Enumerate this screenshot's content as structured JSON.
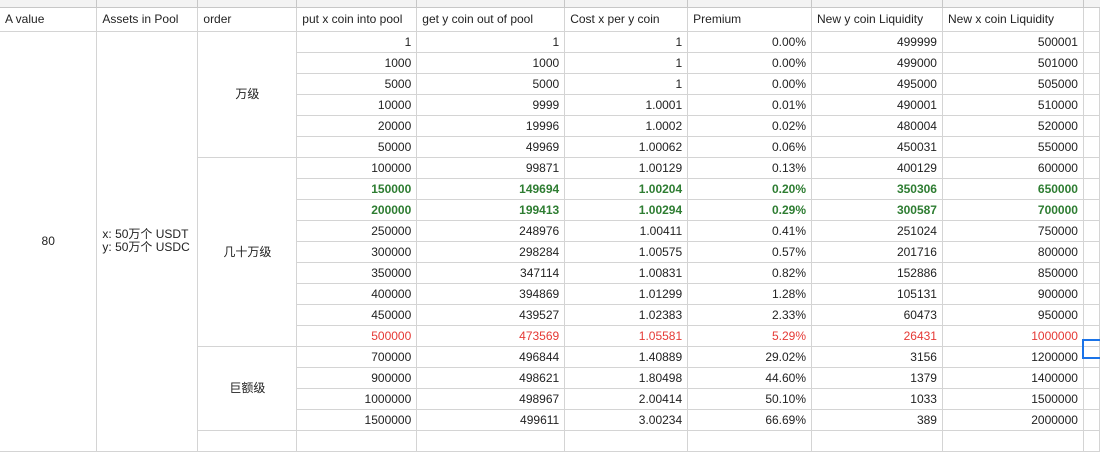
{
  "headers": [
    "A value",
    "Assets in Pool",
    "order",
    "put x coin into pool",
    "get y coin out of pool",
    "Cost x per y coin",
    "Premium",
    "New y coin Liquidity",
    "New x coin Liquidity"
  ],
  "a_value": "80",
  "assets": [
    "x: 50万个 USDT",
    "y: 50万个 USDC"
  ],
  "groups": [
    {
      "label": "万级",
      "start": 0,
      "span": 6
    },
    {
      "label": "几十万级",
      "start": 6,
      "span": 9
    },
    {
      "label": "巨额级",
      "start": 15,
      "span": 4
    }
  ],
  "rows": [
    {
      "put": "1",
      "get": "1",
      "cost": "1",
      "premium": "0.00%",
      "new_y": "499999",
      "new_x": "500001",
      "style": ""
    },
    {
      "put": "1000",
      "get": "1000",
      "cost": "1",
      "premium": "0.00%",
      "new_y": "499000",
      "new_x": "501000",
      "style": ""
    },
    {
      "put": "5000",
      "get": "5000",
      "cost": "1",
      "premium": "0.00%",
      "new_y": "495000",
      "new_x": "505000",
      "style": ""
    },
    {
      "put": "10000",
      "get": "9999",
      "cost": "1.0001",
      "premium": "0.01%",
      "new_y": "490001",
      "new_x": "510000",
      "style": ""
    },
    {
      "put": "20000",
      "get": "19996",
      "cost": "1.0002",
      "premium": "0.02%",
      "new_y": "480004",
      "new_x": "520000",
      "style": ""
    },
    {
      "put": "50000",
      "get": "49969",
      "cost": "1.00062",
      "premium": "0.06%",
      "new_y": "450031",
      "new_x": "550000",
      "style": ""
    },
    {
      "put": "100000",
      "get": "99871",
      "cost": "1.00129",
      "premium": "0.13%",
      "new_y": "400129",
      "new_x": "600000",
      "style": ""
    },
    {
      "put": "150000",
      "get": "149694",
      "cost": "1.00204",
      "premium": "0.20%",
      "new_y": "350306",
      "new_x": "650000",
      "style": "green"
    },
    {
      "put": "200000",
      "get": "199413",
      "cost": "1.00294",
      "premium": "0.29%",
      "new_y": "300587",
      "new_x": "700000",
      "style": "green"
    },
    {
      "put": "250000",
      "get": "248976",
      "cost": "1.00411",
      "premium": "0.41%",
      "new_y": "251024",
      "new_x": "750000",
      "style": ""
    },
    {
      "put": "300000",
      "get": "298284",
      "cost": "1.00575",
      "premium": "0.57%",
      "new_y": "201716",
      "new_x": "800000",
      "style": ""
    },
    {
      "put": "350000",
      "get": "347114",
      "cost": "1.00831",
      "premium": "0.82%",
      "new_y": "152886",
      "new_x": "850000",
      "style": ""
    },
    {
      "put": "400000",
      "get": "394869",
      "cost": "1.01299",
      "premium": "1.28%",
      "new_y": "105131",
      "new_x": "900000",
      "style": ""
    },
    {
      "put": "450000",
      "get": "439527",
      "cost": "1.02383",
      "premium": "2.33%",
      "new_y": "60473",
      "new_x": "950000",
      "style": ""
    },
    {
      "put": "500000",
      "get": "473569",
      "cost": "1.05581",
      "premium": "5.29%",
      "new_y": "26431",
      "new_x": "1000000",
      "style": "red"
    },
    {
      "put": "700000",
      "get": "496844",
      "cost": "1.40889",
      "premium": "29.02%",
      "new_y": "3156",
      "new_x": "1200000",
      "style": ""
    },
    {
      "put": "900000",
      "get": "498621",
      "cost": "1.80498",
      "premium": "44.60%",
      "new_y": "1379",
      "new_x": "1400000",
      "style": ""
    },
    {
      "put": "1000000",
      "get": "498967",
      "cost": "2.00414",
      "premium": "50.10%",
      "new_y": "1033",
      "new_x": "1500000",
      "style": ""
    },
    {
      "put": "1500000",
      "get": "499611",
      "cost": "3.00234",
      "premium": "66.69%",
      "new_y": "389",
      "new_x": "2000000",
      "style": ""
    }
  ],
  "colors": {
    "green": "#2e7d32",
    "red": "#e53935",
    "selection": "#1a73e8"
  }
}
